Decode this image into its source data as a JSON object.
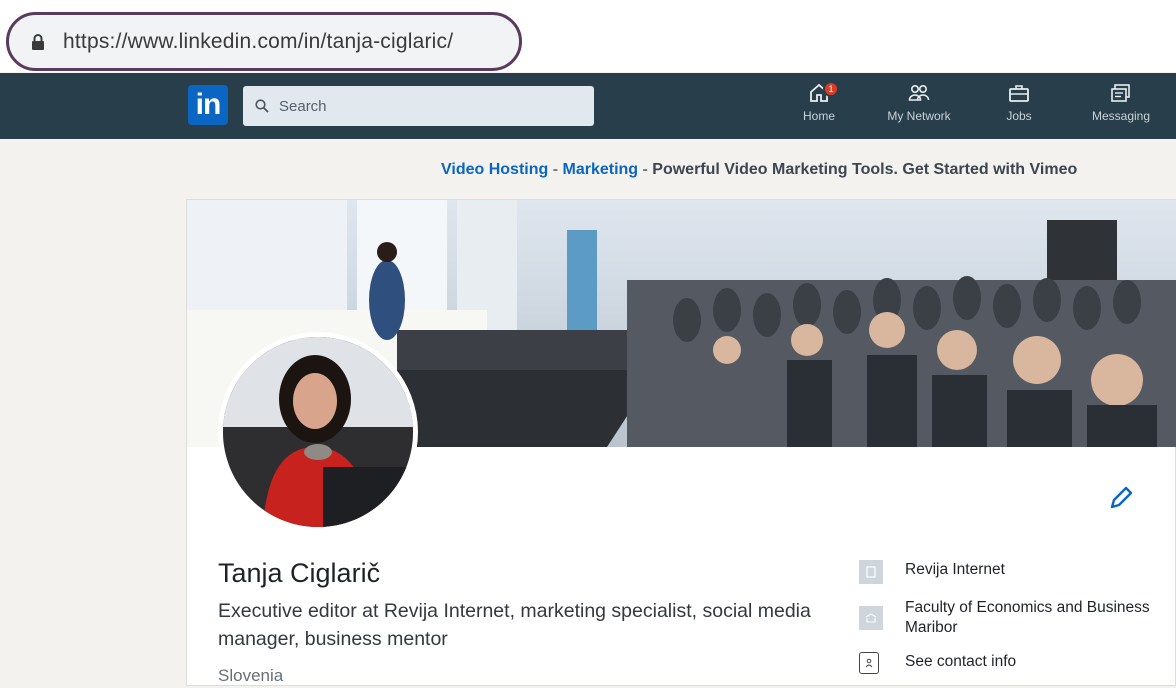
{
  "browser": {
    "url": "https://www.linkedin.com/in/tanja-ciglaric/"
  },
  "nav": {
    "logo": "in",
    "search_placeholder": "Search",
    "items": [
      {
        "label": "Home",
        "icon": "home-icon"
      },
      {
        "label": "My Network",
        "icon": "network-icon"
      },
      {
        "label": "Jobs",
        "icon": "briefcase-icon"
      },
      {
        "label": "Messaging",
        "icon": "messaging-icon"
      }
    ],
    "home_badge": "1"
  },
  "ad": {
    "link1": "Video Hosting",
    "sep1": " - ",
    "link2": "Marketing",
    "sep2": " - ",
    "copy": "Powerful Video Marketing Tools. Get Started with Vimeo"
  },
  "profile": {
    "name": "Tanja Ciglarič",
    "headline": "Executive editor at Revija Internet, marketing specialist, social media manager, business mentor",
    "location": "Slovenia",
    "current_company": "Revija Internet",
    "education": "Faculty of Economics and Business Maribor",
    "contact_link": "See contact info"
  },
  "colors": {
    "nav_bg": "#283e4a",
    "brand_blue": "#0a66c2",
    "url_highlight": "#5a3b5e"
  }
}
